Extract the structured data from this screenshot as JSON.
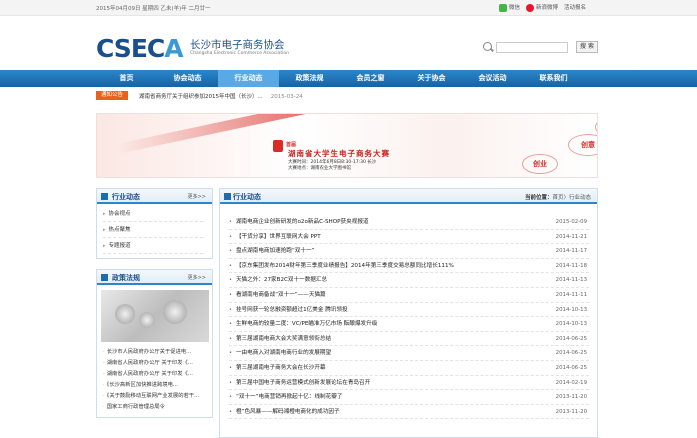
{
  "topbar": {
    "date": "2015年04月09日 星期四 乙未(羊)年 二月廿一",
    "weixin": "微信",
    "weibo": "新浪微博",
    "register": "活动报名"
  },
  "header": {
    "logo_part1": "CSEC",
    "logo_part2": "A",
    "name_cn": "长沙市电子商务协会",
    "name_en": "Changsha Electronic Commerce Association",
    "search_placeholder": "",
    "search_button": "搜 索"
  },
  "nav": {
    "items": [
      {
        "label": "首页",
        "active": false
      },
      {
        "label": "协会动态",
        "active": false
      },
      {
        "label": "行业动态",
        "active": true
      },
      {
        "label": "政策法规",
        "active": false
      },
      {
        "label": "会员之窗",
        "active": false
      },
      {
        "label": "关于协会",
        "active": false
      },
      {
        "label": "会议活动",
        "active": false
      },
      {
        "label": "联系我们",
        "active": false
      }
    ]
  },
  "notice": {
    "tag": "通知公告",
    "text": "湖南省商务厅关于组织参加2015年中国（长沙）...",
    "date": "2015-03-24"
  },
  "banner": {
    "number": "首届",
    "title": "湖南省大学生电子商务大赛",
    "time": "大赛时间：2014年6月8日8:30-17:30 长沙",
    "place": "大赛地点：湖南农业大学图书馆",
    "bubble1": "创新",
    "bubble2": "创意",
    "bubble3": "创业"
  },
  "sidebar": {
    "box1": {
      "title": "行业动态",
      "more": "更多>>",
      "items": [
        "协会视点",
        "热点聚焦",
        "专题报道"
      ]
    },
    "box2": {
      "title": "政策法规",
      "more": "更多>>",
      "items": [
        "长沙市人民政府办公厅关于促进电...",
        "湖南省人民政府办公厅 关于印发《...",
        "湖南省人民政府办公厅 关于印发《...",
        "《长沙高新区加快推进跨境电...",
        "《关于鼓励移动互联网产业发展的若干...",
        "国家工商行政管理总局令"
      ]
    }
  },
  "main": {
    "title": "行业动态",
    "crumb_label": "当前位置：",
    "crumb_home": "首页",
    "crumb_sep": "〉",
    "crumb_current": "行业动态",
    "news": [
      {
        "title": "湖南电商企业创新研发的o2o新品C-SHOP获央视报道",
        "date": "2015-02-09"
      },
      {
        "title": "【干货分享】世界互联网大会 PPT",
        "date": "2014-11-21"
      },
      {
        "title": "盘点湖南电商加速抢跑“双十一”",
        "date": "2014-11-17"
      },
      {
        "title": "【京东集团发布2014财年第三季度业绩报告】2014年第三季度交易总额同比增长111%",
        "date": "2014-11-18"
      },
      {
        "title": "天猫之外：27家B2C双十一数据汇总",
        "date": "2014-11-13"
      },
      {
        "title": "看湖南电商备战“双十一”——天猫篇",
        "date": "2014-11-11"
      },
      {
        "title": "挂号网获一轮总融资额超过1亿美金 腾讯领投",
        "date": "2014-10-13"
      },
      {
        "title": "生鲜电商的较量二度：VC/PE瞄准万亿市场 酝酿爆发升级",
        "date": "2014-10-13"
      },
      {
        "title": "第三届湖南电商大会大奖满意领衔总结",
        "date": "2014-06-25"
      },
      {
        "title": "一由电商入对湖南电商行业的发展期望",
        "date": "2014-06-25"
      },
      {
        "title": "第三届湖南电子商务大会在长沙开幕",
        "date": "2014-06-25"
      },
      {
        "title": "第三届中国电子商务运营模式创新发展论坛在青岛召开",
        "date": "2014-02-19"
      },
      {
        "title": "“双十一”电商营销再掀起十亿：线制花瓣了",
        "date": "2013-11-20"
      },
      {
        "title": "橙”色风暴——解码湘橙电商化的成功因子",
        "date": "2013-11-20"
      }
    ]
  }
}
